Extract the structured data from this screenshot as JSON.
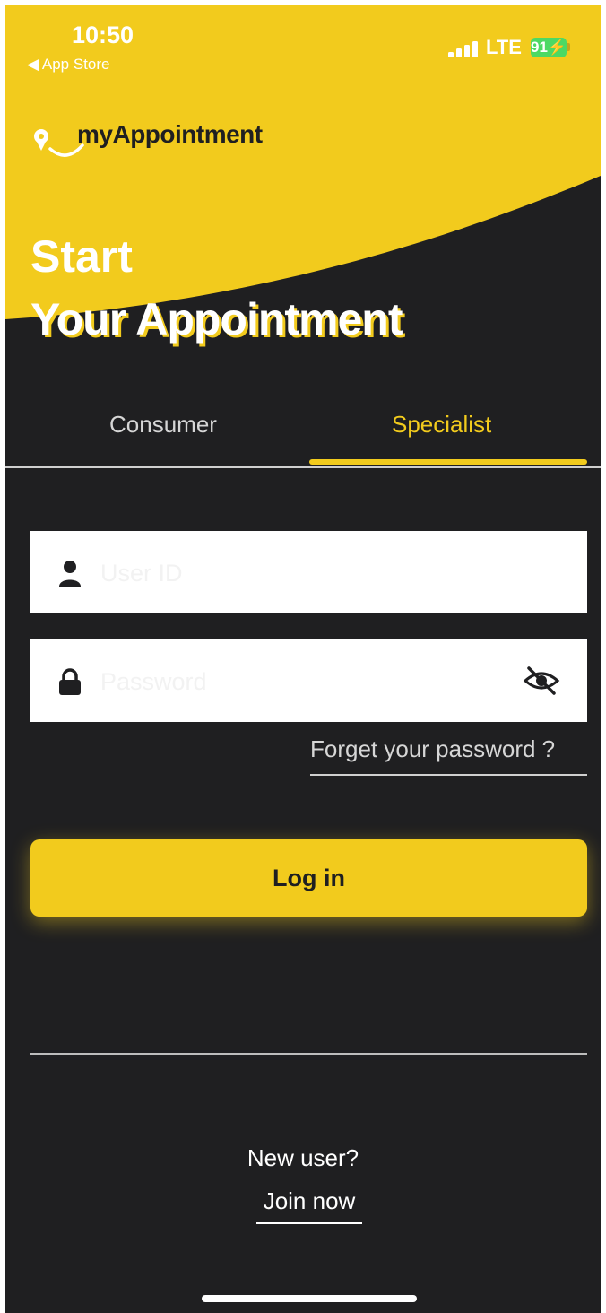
{
  "status_bar": {
    "time": "10:50",
    "back_label": "◀ App Store",
    "network": "LTE",
    "battery": "91"
  },
  "brand": {
    "logo_text": "myAppointment",
    "color_yellow": "#f2cb1d",
    "color_dark": "#1f1f21"
  },
  "hero": {
    "line1": "Start",
    "line2": "Your Appointment"
  },
  "tabs": [
    {
      "label": "Consumer",
      "selected": false
    },
    {
      "label": "Specialist",
      "selected": true
    }
  ],
  "form": {
    "user_id_placeholder": "User ID",
    "password_placeholder": "Password",
    "user_icon": "user-icon",
    "lock_icon": "lock-icon",
    "visibility_icon": "eye-off-icon",
    "forgot_label": "Forget your password ?",
    "login_label": "Log in"
  },
  "footer": {
    "new_user_label": "New user?",
    "join_label": "Join now"
  }
}
